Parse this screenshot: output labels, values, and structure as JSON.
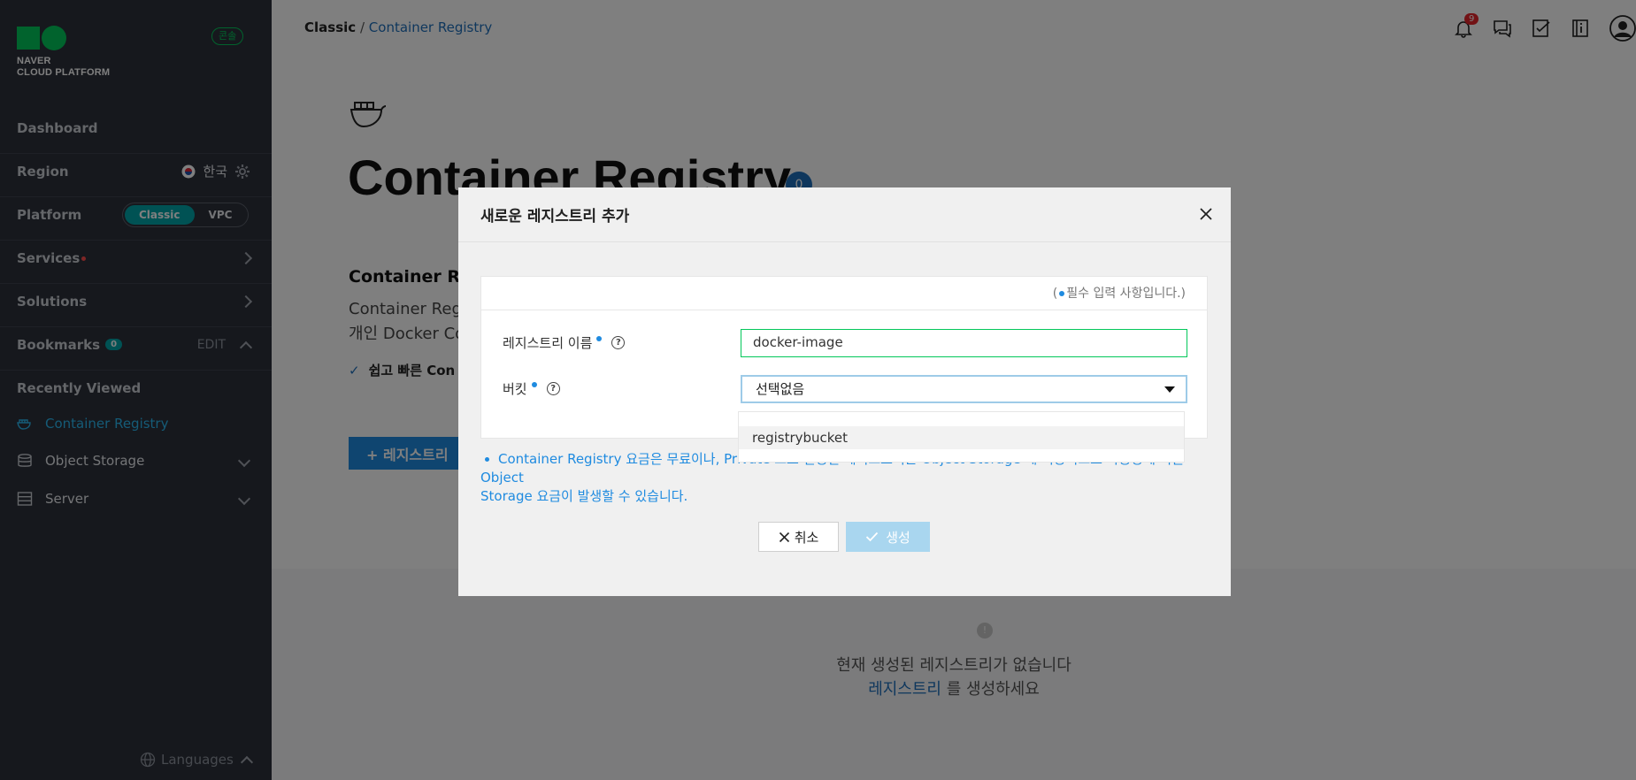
{
  "sidebar": {
    "brand": {
      "line1": "NAVER",
      "line2": "CLOUD PLATFORM"
    },
    "console_badge": "콘솔",
    "dashboard": "Dashboard",
    "region": {
      "label": "Region",
      "value": "한국"
    },
    "platform": {
      "label": "Platform",
      "options": [
        "Classic",
        "VPC"
      ],
      "selected": "Classic"
    },
    "services": "Services",
    "solutions": "Solutions",
    "bookmarks": {
      "label": "Bookmarks",
      "count": "0",
      "edit": "EDIT"
    },
    "recently_viewed": {
      "label": "Recently Viewed",
      "items": [
        {
          "label": "Container Registry",
          "icon": "whale-icon",
          "active": true
        },
        {
          "label": "Object Storage",
          "icon": "storage-icon"
        },
        {
          "label": "Server",
          "icon": "server-icon"
        }
      ]
    },
    "languages": "Languages"
  },
  "header": {
    "breadcrumb": [
      "Classic",
      "Container Registry"
    ],
    "separator": "/",
    "notification_count": "9",
    "icons": [
      "bell-icon",
      "chat-icon",
      "memo-icon",
      "info-book-icon",
      "user-avatar-icon"
    ]
  },
  "main": {
    "title": "Container Registry",
    "count": "0",
    "section_title": "Container Reg",
    "desc_line1": "Container Regist",
    "desc_line2": "개인 Docker Con",
    "feature": "쉽고 빠른 Con",
    "add_button": "+ 레지스트리",
    "empty_line1": "현재 생성된 레지스트리가 없습니다",
    "empty_link": "레지스트리",
    "empty_line2_rest": " 를 생성하세요"
  },
  "modal": {
    "title": "새로운 레지스트리 추가",
    "required_note_open": "(",
    "required_note": "필수 입력 사항입니다.)",
    "name_label": "레지스트리 이름",
    "name_value": "docker-image",
    "bucket_label": "버킷",
    "bucket_selected": "선택없음",
    "bucket_options": [
      "registrybucket"
    ],
    "notice_line1": "Container Registry 요금은 무료이나, Private 으로 설정된 레지스트리는 Object Storage 에 저장되므로 사용량에 따른 Object",
    "notice_line2": "Storage 요금이 발생할 수 있습니다.",
    "cancel": "취소",
    "create": "생성"
  },
  "colors": {
    "accent": "#03c75a",
    "link": "#1f6fba",
    "sidebar_bg": "#2c303b",
    "teal": "#00a5a8"
  }
}
